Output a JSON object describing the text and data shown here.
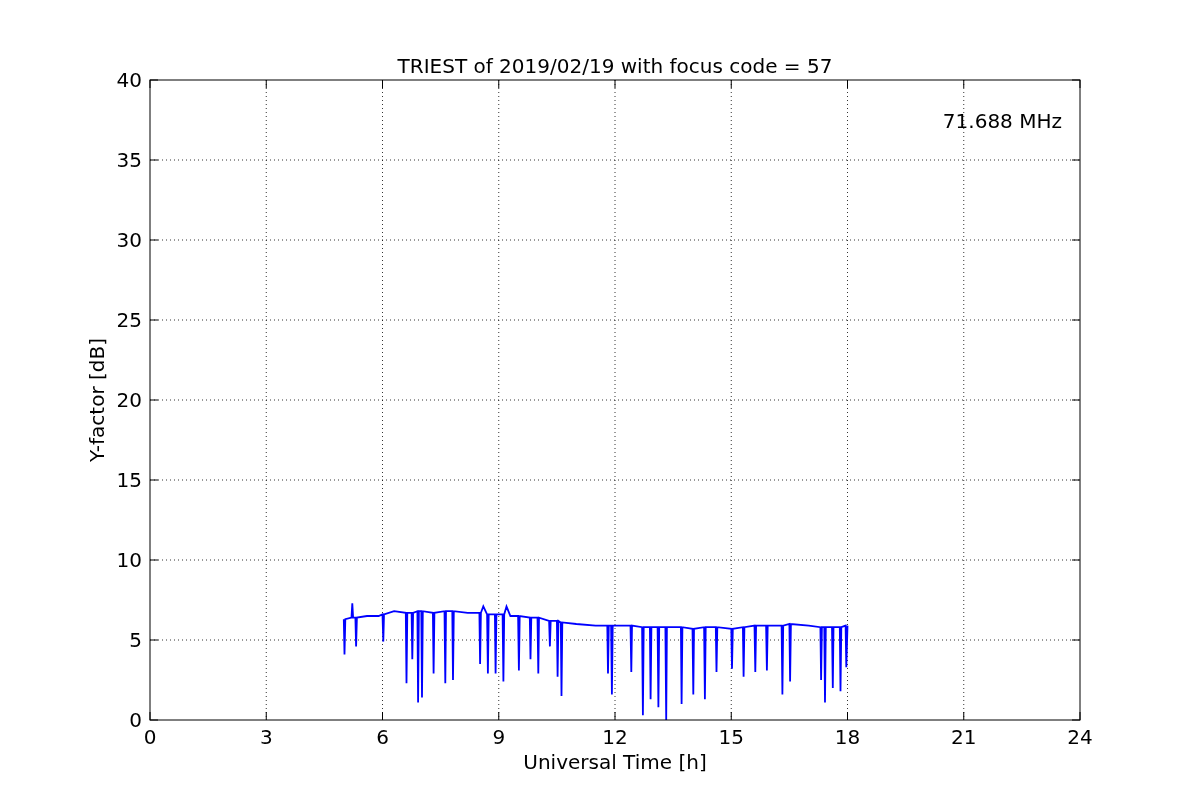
{
  "chart_data": {
    "type": "line",
    "title": "TRIEST of 2019/02/19 with focus code = 57",
    "xlabel": "Universal Time [h]",
    "ylabel": "Y-factor [dB]",
    "x": [
      5.0,
      5.02,
      5.04,
      5.2,
      5.22,
      5.24,
      5.3,
      5.32,
      5.34,
      5.6,
      5.9,
      6.0,
      6.02,
      6.04,
      6.3,
      6.6,
      6.62,
      6.64,
      6.75,
      6.77,
      6.79,
      6.9,
      6.92,
      6.94,
      7.0,
      7.02,
      7.04,
      7.3,
      7.32,
      7.34,
      7.6,
      7.62,
      7.64,
      7.8,
      7.82,
      7.84,
      8.2,
      8.5,
      8.52,
      8.54,
      8.6,
      8.7,
      8.72,
      8.74,
      8.9,
      8.92,
      8.94,
      9.1,
      9.12,
      9.14,
      9.2,
      9.3,
      9.5,
      9.52,
      9.54,
      9.8,
      9.82,
      9.84,
      10.0,
      10.02,
      10.04,
      10.3,
      10.32,
      10.34,
      10.5,
      10.52,
      10.54,
      10.6,
      10.62,
      10.64,
      11.0,
      11.5,
      11.8,
      11.82,
      11.84,
      11.9,
      11.92,
      11.94,
      12.2,
      12.4,
      12.42,
      12.44,
      12.7,
      12.72,
      12.74,
      12.9,
      12.92,
      12.94,
      13.1,
      13.12,
      13.14,
      13.3,
      13.32,
      13.34,
      13.7,
      13.72,
      13.74,
      14.0,
      14.02,
      14.04,
      14.3,
      14.32,
      14.34,
      14.6,
      14.62,
      14.64,
      15.0,
      15.02,
      15.04,
      15.3,
      15.32,
      15.34,
      15.6,
      15.62,
      15.64,
      15.9,
      15.92,
      15.94,
      16.3,
      16.32,
      16.34,
      16.5,
      16.52,
      16.54,
      17.0,
      17.3,
      17.32,
      17.34,
      17.4,
      17.42,
      17.44,
      17.6,
      17.62,
      17.64,
      17.8,
      17.82,
      17.84,
      17.95,
      17.97,
      18.0
    ],
    "series": [
      {
        "color": "#0000ff",
        "values": [
          6.3,
          4.1,
          6.3,
          6.4,
          7.3,
          6.4,
          6.4,
          4.6,
          6.4,
          6.5,
          6.5,
          6.6,
          4.9,
          6.6,
          6.8,
          6.7,
          2.3,
          6.7,
          6.7,
          3.8,
          6.7,
          6.8,
          1.1,
          6.8,
          6.8,
          1.4,
          6.8,
          6.7,
          2.9,
          6.7,
          6.8,
          2.3,
          6.8,
          6.8,
          2.5,
          6.8,
          6.7,
          6.7,
          3.5,
          6.7,
          7.1,
          6.6,
          2.9,
          6.6,
          6.6,
          2.9,
          6.6,
          6.6,
          2.4,
          6.6,
          7.1,
          6.5,
          6.5,
          3.1,
          6.5,
          6.4,
          3.8,
          6.4,
          6.4,
          2.9,
          6.4,
          6.2,
          4.6,
          6.2,
          6.2,
          2.7,
          6.2,
          6.1,
          1.5,
          6.1,
          6.0,
          5.9,
          5.9,
          2.9,
          5.9,
          5.9,
          1.6,
          5.9,
          5.9,
          5.9,
          3.0,
          5.9,
          5.8,
          0.3,
          5.8,
          5.8,
          1.3,
          5.8,
          5.8,
          0.8,
          5.8,
          5.8,
          0.0,
          5.8,
          5.8,
          1.0,
          5.8,
          5.7,
          1.6,
          5.7,
          5.8,
          1.3,
          5.8,
          5.8,
          3.0,
          5.8,
          5.7,
          3.2,
          5.7,
          5.8,
          2.7,
          5.8,
          5.9,
          3.0,
          5.9,
          5.9,
          3.1,
          5.9,
          5.9,
          1.6,
          5.9,
          6.0,
          2.4,
          6.0,
          5.9,
          5.8,
          2.5,
          5.8,
          5.8,
          1.1,
          5.8,
          5.8,
          2.0,
          5.8,
          5.8,
          1.8,
          5.8,
          5.9,
          3.3,
          5.9
        ]
      }
    ],
    "xlim": [
      0,
      24
    ],
    "ylim": [
      0,
      40
    ],
    "xticks": [
      0,
      3,
      6,
      9,
      12,
      15,
      18,
      21,
      24
    ],
    "yticks": [
      0,
      5,
      10,
      15,
      20,
      25,
      30,
      35,
      40
    ],
    "grid": true,
    "annotations": [
      {
        "text": "71.688 MHz"
      }
    ]
  }
}
